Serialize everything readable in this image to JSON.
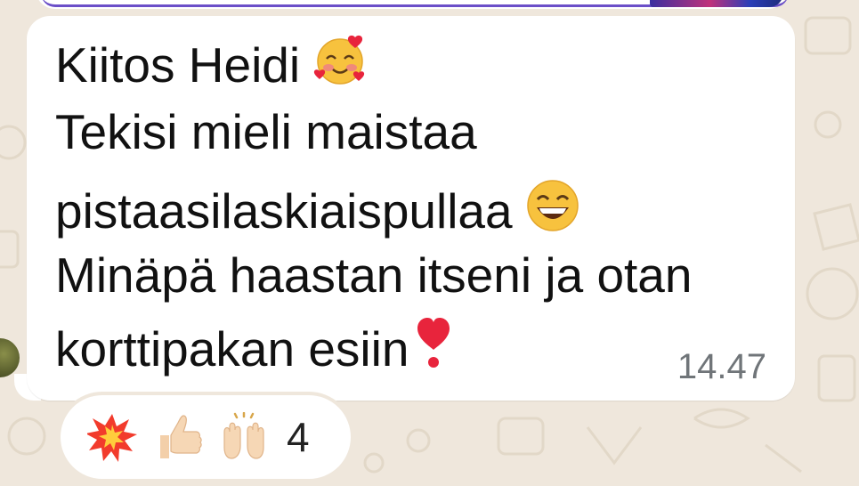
{
  "chat": {
    "message": {
      "lines": [
        "Kiitos Heidi",
        "Tekisi mieli maistaa",
        "pistaasilaskiaispullaa",
        "Minäpä haastan itseni ja otan",
        "korttipakan esiin"
      ],
      "emojis": {
        "line1": "smiling-face-with-hearts-icon",
        "line3": "grinning-face-icon",
        "line5": "red-heart-exclamation-icon"
      },
      "time": "14.47"
    },
    "reactions": {
      "icons": [
        "collision-icon",
        "thumbs-up-icon",
        "raising-hands-icon"
      ],
      "count": "4"
    }
  },
  "colors": {
    "wallpaper": "#efe7dc",
    "bubble": "#ffffff",
    "time_text": "#707579"
  }
}
